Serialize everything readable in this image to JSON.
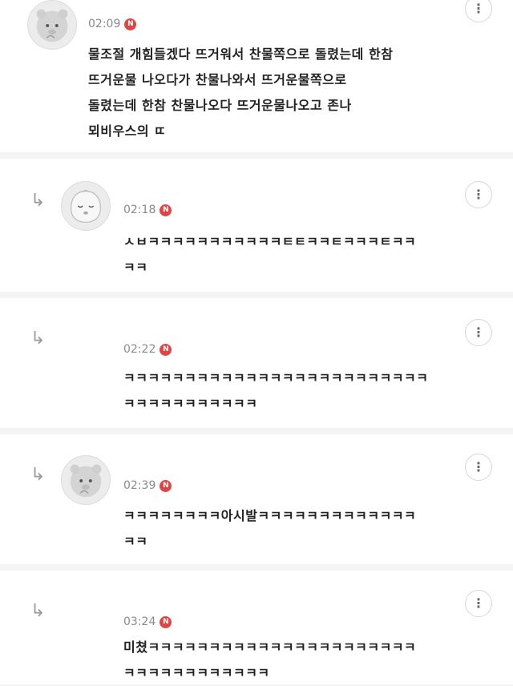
{
  "comments": [
    {
      "time": "02:09",
      "badge": "N",
      "lines": [
        "물조절 개힘들겠다 뜨거워서 찬물쪽으로 돌렸는데 한참",
        "뜨거운물 나오다가 찬물나와서 뜨거운물쪽으로",
        "돌렸는데 한참 찬물나오다 뜨거운물나오고 존나",
        "뫼비우스의 ㄸ"
      ],
      "avatar": "bear-avatar",
      "menu": "⋮"
    },
    {
      "time": "02:18",
      "badge": "N",
      "lines": [
        "ㅅㅂㅋㅋㅋㅋㅋㅋㅋㅋㅋㅋㅋㅌㅌㅋㅋㅌㅋㅋㅋㅌㅋㅋ",
        "ㅋㅋ"
      ],
      "avatar": "peach-avatar",
      "menu": "⋮",
      "reply_icon": "↳"
    },
    {
      "time": "02:22",
      "badge": "N",
      "lines": [
        "ㅋㅋㅋㅋㅋㅋㅋㅋㅋㅋㅋㅋㅋㅋㅋㅋㅋㅋㅋㅋㅋㅋㅋㅋㅋ",
        "ㅋㅋㅋㅋㅋㅋㅋㅋㅋㅋㅋ"
      ],
      "menu": "⋮",
      "reply_icon": "↳"
    },
    {
      "time": "02:39",
      "badge": "N",
      "lines": [
        "ㅋㅋㅋㅋㅋㅋㅋㅋ아시발ㅋㅋㅋㅋㅋㅋㅋㅋㅋㅋㅋㅋㅋ",
        "ㅋㅋ"
      ],
      "avatar": "bear-avatar",
      "menu": "⋮",
      "reply_icon": "↳"
    },
    {
      "time": "03:24",
      "badge": "N",
      "lines": [
        "미쳤ㅋㅋㅋㅋㅋㅋㅋㅋㅋㅋㅋㅋㅋㅋㅋㅋㅋㅋㅋㅋㅋㅋ",
        "ㅋㅋㅋㅋㅋㅋㅋㅋㅋㅋㅋㅋ"
      ],
      "menu": "⋮",
      "reply_icon": "↳"
    }
  ]
}
